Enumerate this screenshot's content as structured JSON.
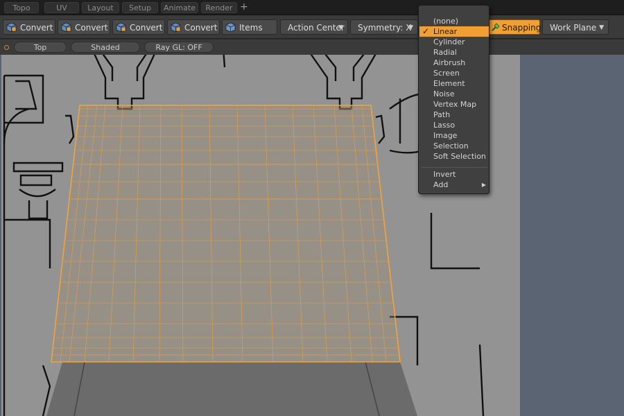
{
  "tabs": [
    "Topo",
    "UV",
    "Layout",
    "Setup",
    "Animate",
    "Render"
  ],
  "tab_plus": "+",
  "toolbar": {
    "convert_buttons": [
      "Convert",
      "Convert",
      "Convert",
      "Convert"
    ],
    "items_label": "Items",
    "action_center_label": "Action Center",
    "symmetry_label": "Symmetry: X",
    "snapping_label": "Snapping",
    "work_plane_label": "Work Plane"
  },
  "viewport": {
    "view_label": "Top",
    "shading_label": "Shaded",
    "ray_label": "Ray GL: OFF"
  },
  "falloff_menu": {
    "items": [
      "(none)",
      "Linear",
      "Cylinder",
      "Radial",
      "Airbrush",
      "Screen",
      "Element",
      "Noise",
      "Vertex Map",
      "Path",
      "Lasso",
      "Image",
      "Selection",
      "Soft Selection"
    ],
    "selected": "Linear",
    "checkmark": "✓",
    "extra_items": [
      "Invert",
      "Add"
    ],
    "submenu_arrow": "▶"
  },
  "colors": {
    "accent": "#f0a033",
    "wire": "#f2a43a",
    "viewport_bg": "#5a6473",
    "toolbar_bg": "#3a3a3a"
  },
  "icons": {
    "convert": "cube-convert-icon",
    "items": "cube-items-icon",
    "snapping": "magnet-snap-icon",
    "caret": "caret-down-icon"
  }
}
